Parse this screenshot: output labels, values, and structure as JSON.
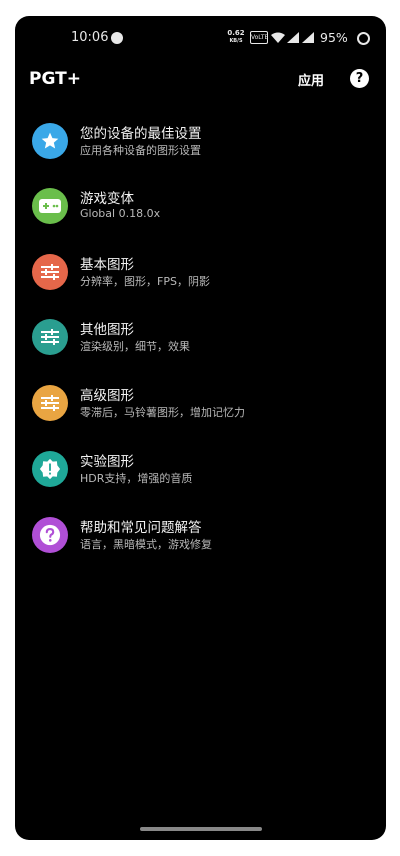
{
  "status": {
    "time": "10:06",
    "speed_value": "0.62",
    "speed_unit": "KB/S",
    "volte": "VoLTE",
    "battery": "95%"
  },
  "appbar": {
    "title": "PGT+",
    "apply_label": "应用",
    "help_glyph": "?"
  },
  "colors": {
    "background": "#000000",
    "item_icons": [
      "#3aa8e8",
      "#6abe4b",
      "#e5674a",
      "#2a9e90",
      "#e9a542",
      "#1fa898",
      "#b04fd6"
    ]
  },
  "items": [
    {
      "title": "您的设备的最佳设置",
      "subtitle": "应用各种设备的图形设置",
      "icon": "star-icon"
    },
    {
      "title": "游戏变体",
      "subtitle": "Global 0.18.0x",
      "icon": "gamepad-icon"
    },
    {
      "title": "基本图形",
      "subtitle": "分辨率，图形，FPS，阴影",
      "icon": "sliders-icon"
    },
    {
      "title": "其他图形",
      "subtitle": "渲染级别，细节，效果",
      "icon": "sliders-icon"
    },
    {
      "title": "高级图形",
      "subtitle": "零滞后，马铃薯图形，增加记忆力",
      "icon": "sliders-icon"
    },
    {
      "title": "实验图形",
      "subtitle": "HDR支持，增强的音质",
      "icon": "badge-alert-icon"
    },
    {
      "title": "帮助和常见问题解答",
      "subtitle": "语言，黑暗模式，游戏修复",
      "icon": "question-icon"
    }
  ]
}
